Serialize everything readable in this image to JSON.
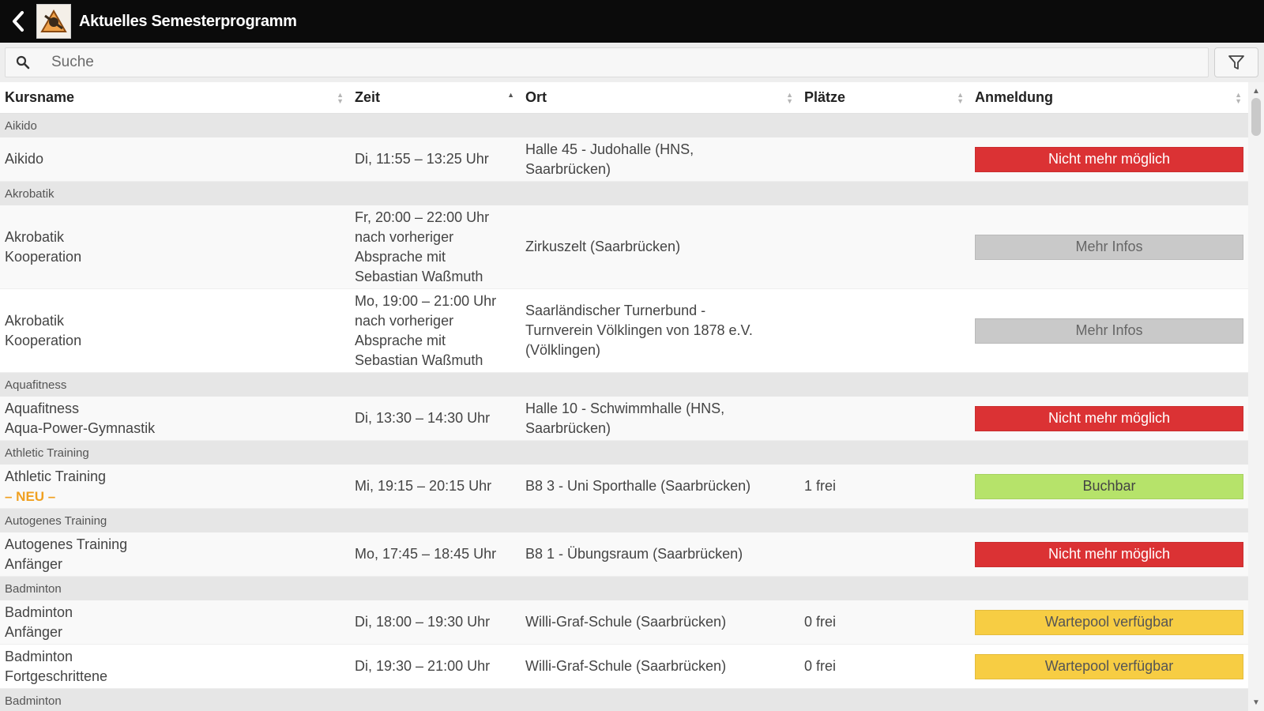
{
  "header": {
    "title": "Aktuelles Semesterprogramm",
    "back_icon": "back-arrow-icon",
    "logo_icon": "app-logo-icon"
  },
  "search": {
    "placeholder": "Suche",
    "value": "",
    "icon": "search-icon",
    "filter_icon": "filter-icon"
  },
  "columns": [
    "Kursname",
    "Zeit",
    "Ort",
    "Plätze",
    "Anmeldung"
  ],
  "status_colors": {
    "red": "#db3234",
    "gray": "#c9c9c9",
    "green": "#b6e36a",
    "yellow": "#f7cd43"
  },
  "groups": [
    {
      "name": "Aikido",
      "rows": [
        {
          "name": [
            "Aikido"
          ],
          "zeit": [
            "Di, 11:55 – 13:25 Uhr"
          ],
          "ort": [
            "Halle 45 - Judohalle (HNS,",
            "Saarbrücken)"
          ],
          "plaetze": "",
          "status": "Nicht mehr möglich",
          "status_type": "red"
        }
      ]
    },
    {
      "name": "Akrobatik",
      "rows": [
        {
          "name": [
            "Akrobatik",
            "Kooperation"
          ],
          "zeit": [
            "Fr, 20:00 – 22:00 Uhr",
            "nach vorheriger",
            "Absprache mit",
            "Sebastian Waßmuth"
          ],
          "ort": [
            "Zirkuszelt (Saarbrücken)"
          ],
          "plaetze": "",
          "status": "Mehr Infos",
          "status_type": "gray"
        },
        {
          "name": [
            "Akrobatik",
            "Kooperation"
          ],
          "zeit": [
            "Mo, 19:00 – 21:00 Uhr",
            "nach vorheriger",
            "Absprache mit",
            "Sebastian Waßmuth"
          ],
          "ort": [
            "Saarländischer Turnerbund -",
            "Turnverein Völklingen von 1878 e.V.",
            "(Völklingen)"
          ],
          "plaetze": "",
          "status": "Mehr Infos",
          "status_type": "gray"
        }
      ]
    },
    {
      "name": "Aquafitness",
      "rows": [
        {
          "name": [
            "Aquafitness",
            "Aqua-Power-Gymnastik"
          ],
          "zeit": [
            "Di, 13:30 – 14:30 Uhr"
          ],
          "ort": [
            "Halle 10 - Schwimmhalle (HNS,",
            "Saarbrücken)"
          ],
          "plaetze": "",
          "status": "Nicht mehr möglich",
          "status_type": "red"
        }
      ]
    },
    {
      "name": "Athletic Training",
      "rows": [
        {
          "name": [
            "Athletic Training"
          ],
          "badge": "– NEU –",
          "zeit": [
            "Mi, 19:15 – 20:15 Uhr"
          ],
          "ort": [
            "B8 3 - Uni Sporthalle (Saarbrücken)"
          ],
          "plaetze": "1 frei",
          "status": "Buchbar",
          "status_type": "green"
        }
      ]
    },
    {
      "name": "Autogenes Training",
      "rows": [
        {
          "name": [
            "Autogenes Training",
            "Anfänger"
          ],
          "zeit": [
            "Mo, 17:45 – 18:45 Uhr"
          ],
          "ort": [
            "B8 1 - Übungsraum (Saarbrücken)"
          ],
          "plaetze": "",
          "status": "Nicht mehr möglich",
          "status_type": "red"
        }
      ]
    },
    {
      "name": "Badminton",
      "rows": [
        {
          "name": [
            "Badminton",
            "Anfänger"
          ],
          "zeit": [
            "Di, 18:00 – 19:30 Uhr"
          ],
          "ort": [
            "Willi-Graf-Schule (Saarbrücken)"
          ],
          "plaetze": "0 frei",
          "status": "Wartepool verfügbar",
          "status_type": "yellow"
        },
        {
          "name": [
            "Badminton",
            "Fortgeschrittene"
          ],
          "zeit": [
            "Di, 19:30 – 21:00 Uhr"
          ],
          "ort": [
            "Willi-Graf-Schule (Saarbrücken)"
          ],
          "plaetze": "0 frei",
          "status": "Wartepool verfügbar",
          "status_type": "yellow"
        }
      ]
    },
    {
      "name": "Badminton",
      "rows": [
        {
          "name": [
            ""
          ],
          "zeit": [
            ""
          ],
          "ort": [
            ""
          ],
          "plaetze": "",
          "status": "",
          "status_type": "yellow"
        }
      ]
    }
  ]
}
